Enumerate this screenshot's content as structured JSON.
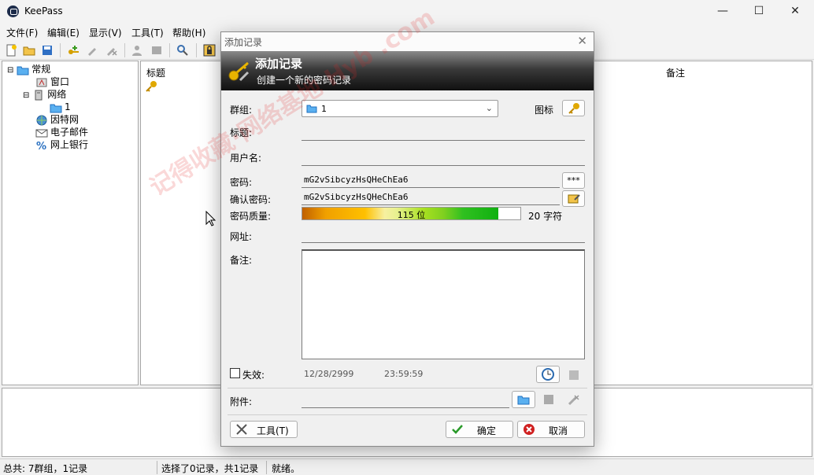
{
  "app": {
    "title": "KeePass"
  },
  "window_controls": {
    "minimize": "—",
    "maximize": "☐",
    "close": "✕"
  },
  "menu": [
    "文件(F)",
    "编辑(E)",
    "显示(V)",
    "工具(T)",
    "帮助(H)"
  ],
  "tree": {
    "root": "常规",
    "items": [
      "窗口",
      "网络",
      "1",
      "因特网",
      "电子邮件",
      "网上银行"
    ]
  },
  "list": {
    "col_title": "标题",
    "col_notes": "备注"
  },
  "status": {
    "total": "总共: 7群组，1记录",
    "selected": "选择了0记录，共1记录",
    "ready": "就绪。"
  },
  "dialog": {
    "window_title": "添加记录",
    "close": "✕",
    "banner_title": "添加记录",
    "banner_subtitle": "创建一个新的密码记录",
    "group_label": "群组:",
    "group_value": "1",
    "icon_label": "图标",
    "title_label": "标题:",
    "username_label": "用户名:",
    "password_label": "密码:",
    "password_value": "mG2vSibcyzHsQHeChEa6",
    "show_password": "***",
    "confirm_label": "确认密码:",
    "confirm_value": "mG2vSibcyzHsQHeChEa6",
    "quality_label": "密码质量:",
    "quality_text": "115 位",
    "quality_fraction": 0.9,
    "char_count": "20 字符",
    "url_label": "网址:",
    "notes_label": "备注:",
    "expires_label": "失效:",
    "expires_date": "12/28/2999",
    "expires_time": "23:59:59",
    "attachments_label": "附件:",
    "tools_button": "工具(T)",
    "ok_button": "确定",
    "cancel_button": "取消"
  },
  "watermark": "记得收藏·网络基地 Hyb .com"
}
